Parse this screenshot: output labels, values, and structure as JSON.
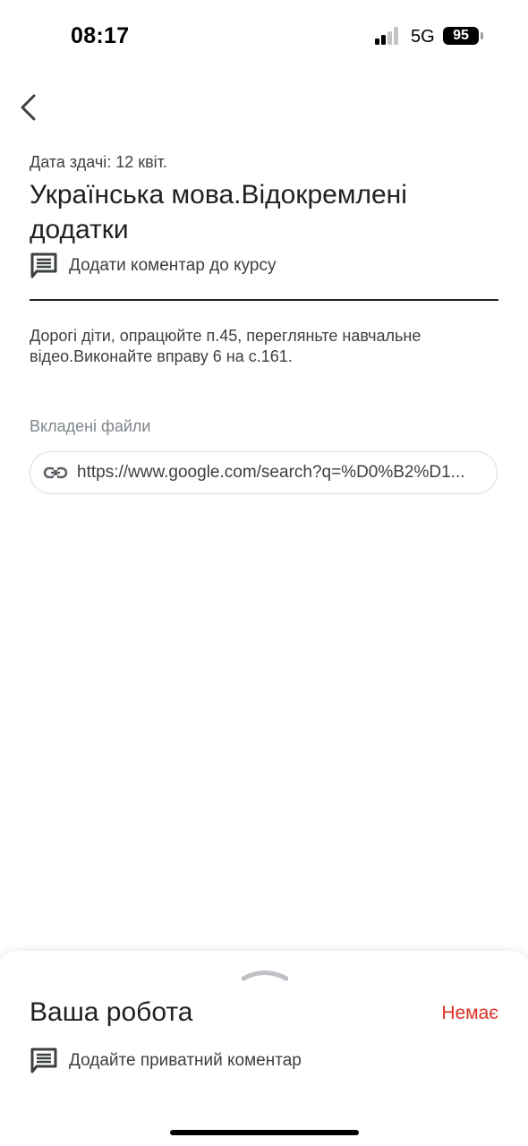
{
  "status_bar": {
    "time": "08:17",
    "network": "5G",
    "battery": "95"
  },
  "assignment": {
    "due_date": "Дата здачі: 12 квіт.",
    "title": "Українська мова.Відокремлені додатки",
    "class_comment": "Додати коментар до курсу",
    "instructions": "Дорогі діти, опрацюйте п.45, перегляньте навчальне відео.Виконайте вправу 6 на с.161.",
    "attachments_label": "Вкладені файли",
    "attachment_url": "https://www.google.com/search?q=%D0%B2%D1..."
  },
  "your_work": {
    "title": "Ваша робота",
    "status": "Немає",
    "private_comment": "Додайте приватний коментар"
  },
  "icons": {
    "back": "chevron-left-icon",
    "comment": "comment-icon",
    "link": "link-icon",
    "handle": "chevron-up-icon"
  },
  "colors": {
    "status_missing": "#d93025",
    "text_primary": "#202124",
    "text_secondary": "#3c4043",
    "text_muted": "#80868b"
  }
}
